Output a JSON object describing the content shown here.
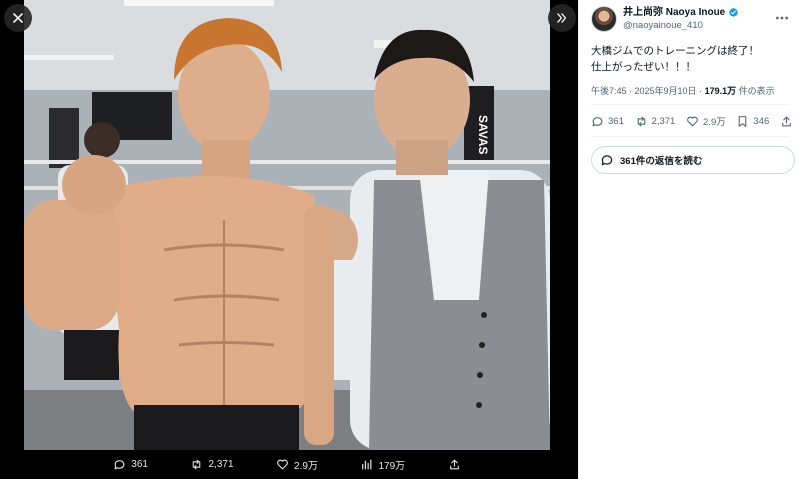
{
  "viewer": {
    "actions": {
      "replies": "361",
      "reposts": "2,371",
      "likes": "2.9万",
      "views": "179万"
    },
    "photo_banner_text": "SAVAS"
  },
  "tweet": {
    "author": {
      "display_name": "井上尚弥 Naoya Inoue",
      "handle": "@naoyainoue_410"
    },
    "text_line1": "大橋ジムでのトレーニングは終了！",
    "text_line2": "仕上がったぜい！！！",
    "time": "午後7:45 · 2025年9月10日 · ",
    "views_count": "179.1万",
    "views_label": " 件の表示",
    "actions": {
      "replies": "361",
      "reposts": "2,371",
      "likes": "2.9万",
      "bookmarks": "346"
    },
    "read_replies": "361件の返信を読む"
  },
  "colors": {
    "accent": "#1d9bf0",
    "text": "#0f1419",
    "secondary": "#536471"
  },
  "icons": [
    "close-icon",
    "collapse-icon",
    "reply-icon",
    "repost-icon",
    "like-icon",
    "views-icon",
    "share-icon",
    "bookmark-icon",
    "more-icon",
    "verified-icon"
  ]
}
